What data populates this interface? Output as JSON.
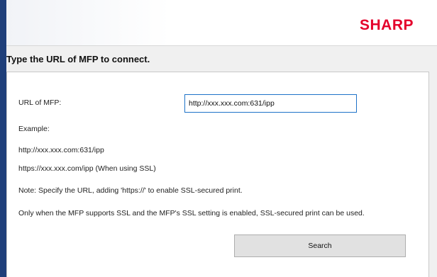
{
  "header": {
    "logo_text": "SHARP",
    "logo_color": "#e4002b",
    "accent_color": "#1f3f7a"
  },
  "page": {
    "title": "Type the URL of MFP to connect."
  },
  "form": {
    "url_label": "URL of MFP:",
    "url_value": "http://xxx.xxx.com:631/ipp",
    "example_label": "Example:",
    "example_http": "http://xxx.xxx.com:631/ipp",
    "example_https": "https://xxx.xxx.com/ipp (When using SSL)",
    "note": "Note: Specify the URL, adding 'https://' to enable SSL-secured print.",
    "ssl_info": "Only when the MFP supports SSL and the MFP's SSL setting is enabled, SSL-secured print can be used.",
    "search_label": "Search"
  }
}
